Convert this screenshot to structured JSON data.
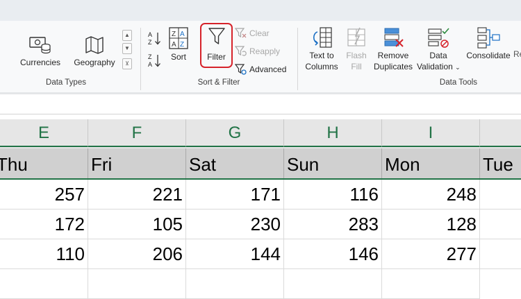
{
  "ribbon": {
    "data_types": {
      "group_label": "Data Types",
      "currencies_label": "Currencies",
      "geography_label": "Geography"
    },
    "sort_filter": {
      "group_label": "Sort & Filter",
      "sort_label": "Sort",
      "filter_label": "Filter",
      "clear_label": "Clear",
      "reapply_label": "Reapply",
      "advanced_label": "Advanced"
    },
    "data_tools": {
      "group_label": "Data Tools",
      "text_to_columns_line1": "Text to",
      "text_to_columns_line2": "Columns",
      "flash_fill_line1": "Flash",
      "flash_fill_line2": "Fill",
      "remove_duplicates_line1": "Remove",
      "remove_duplicates_line2": "Duplicates",
      "data_validation_line1": "Data",
      "data_validation_line2": "Validation",
      "consolidate_label": "Consolidate",
      "cut_off_label": "Re"
    }
  },
  "sheet": {
    "columns": [
      "E",
      "F",
      "G",
      "H",
      "I"
    ],
    "header_row": [
      "Thu",
      "Fri",
      "Sat",
      "Sun",
      "Mon",
      "Tue"
    ],
    "rows": [
      [
        "257",
        "221",
        "171",
        "116",
        "248"
      ],
      [
        "172",
        "105",
        "230",
        "283",
        "128"
      ],
      [
        "110",
        "206",
        "144",
        "146",
        "277"
      ]
    ]
  },
  "colors": {
    "accent_green": "#217346",
    "highlight_red": "#d6222a"
  }
}
